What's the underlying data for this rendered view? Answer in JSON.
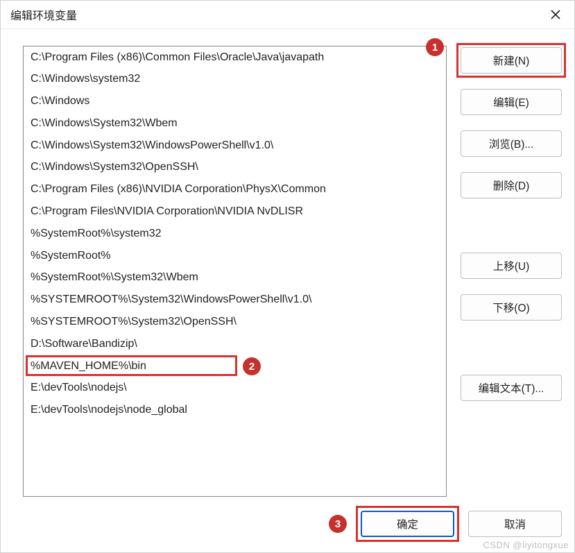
{
  "dialog": {
    "title": "编辑环境变量"
  },
  "list": {
    "items": [
      "C:\\Program Files (x86)\\Common Files\\Oracle\\Java\\javapath",
      "C:\\Windows\\system32",
      "C:\\Windows",
      "C:\\Windows\\System32\\Wbem",
      "C:\\Windows\\System32\\WindowsPowerShell\\v1.0\\",
      "C:\\Windows\\System32\\OpenSSH\\",
      "C:\\Program Files (x86)\\NVIDIA Corporation\\PhysX\\Common",
      "C:\\Program Files\\NVIDIA Corporation\\NVIDIA NvDLISR",
      "%SystemRoot%\\system32",
      "%SystemRoot%",
      "%SystemRoot%\\System32\\Wbem",
      "%SYSTEMROOT%\\System32\\WindowsPowerShell\\v1.0\\",
      "%SYSTEMROOT%\\System32\\OpenSSH\\",
      "D:\\Software\\Bandizip\\",
      "%MAVEN_HOME%\\bin",
      "E:\\devTools\\nodejs\\",
      "E:\\devTools\\nodejs\\node_global"
    ]
  },
  "buttons": {
    "new": "新建(N)",
    "edit": "编辑(E)",
    "browse": "浏览(B)...",
    "delete": "删除(D)",
    "moveup": "上移(U)",
    "movedown": "下移(O)",
    "edittext": "编辑文本(T)...",
    "ok": "确定",
    "cancel": "取消"
  },
  "annotations": {
    "n1": "1",
    "n2": "2",
    "n3": "3"
  },
  "watermark": "CSDN @liyitongxue"
}
